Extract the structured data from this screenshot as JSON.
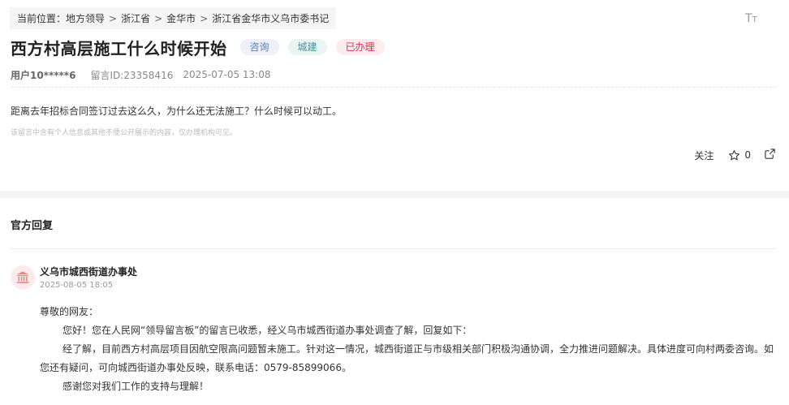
{
  "breadcrumb": {
    "prefix": "当前位置：",
    "items": [
      "地方领导",
      "浙江省",
      "金华市",
      "浙江省金华市义乌市委书记"
    ],
    "separator": ">"
  },
  "font_size_toggle": {
    "label_big": "T",
    "label_small": "T"
  },
  "message": {
    "title": "西方村高层施工什么时候开始",
    "tags": [
      {
        "label": "咨询",
        "color": "#5b7fb5"
      },
      {
        "label": "城建",
        "color": "#4a8f9a"
      },
      {
        "label": "已办理",
        "color": "#d6334a"
      }
    ],
    "user": "用户10*****6",
    "message_id": "留言ID:23358416",
    "datetime": "2025-07-05 13:08",
    "content": "距离去年招标合同签订过去这么久，为什么还无法施工？什么时候可以动工。",
    "notice": "该留言中含有个人信息或其他不便公开展示的内容，仅办理机构可见。"
  },
  "actions": {
    "follow_label": "关注",
    "like_count": "0"
  },
  "official_reply": {
    "section_title": "官方回复",
    "org_name": "义乌市城西街道办事处",
    "date": "2025-08-05 18:05",
    "paragraphs": [
      "尊敬的网友：",
      "您好！您在人民网“领导留言板”的留言已收悉，经义乌市城西街道办事处调查了解，回复如下：",
      "经了解，目前西方村高层项目因航空限高问题暂未施工。针对这一情况，城西街道正与市级相关部门积极沟通协调，全力推进问题解决。具体进度可向村两委咨询。如您还有疑问，可向城西街道办事处反映，联系电话：0579-85899066。",
      "感谢您对我们工作的支持与理解！"
    ]
  }
}
